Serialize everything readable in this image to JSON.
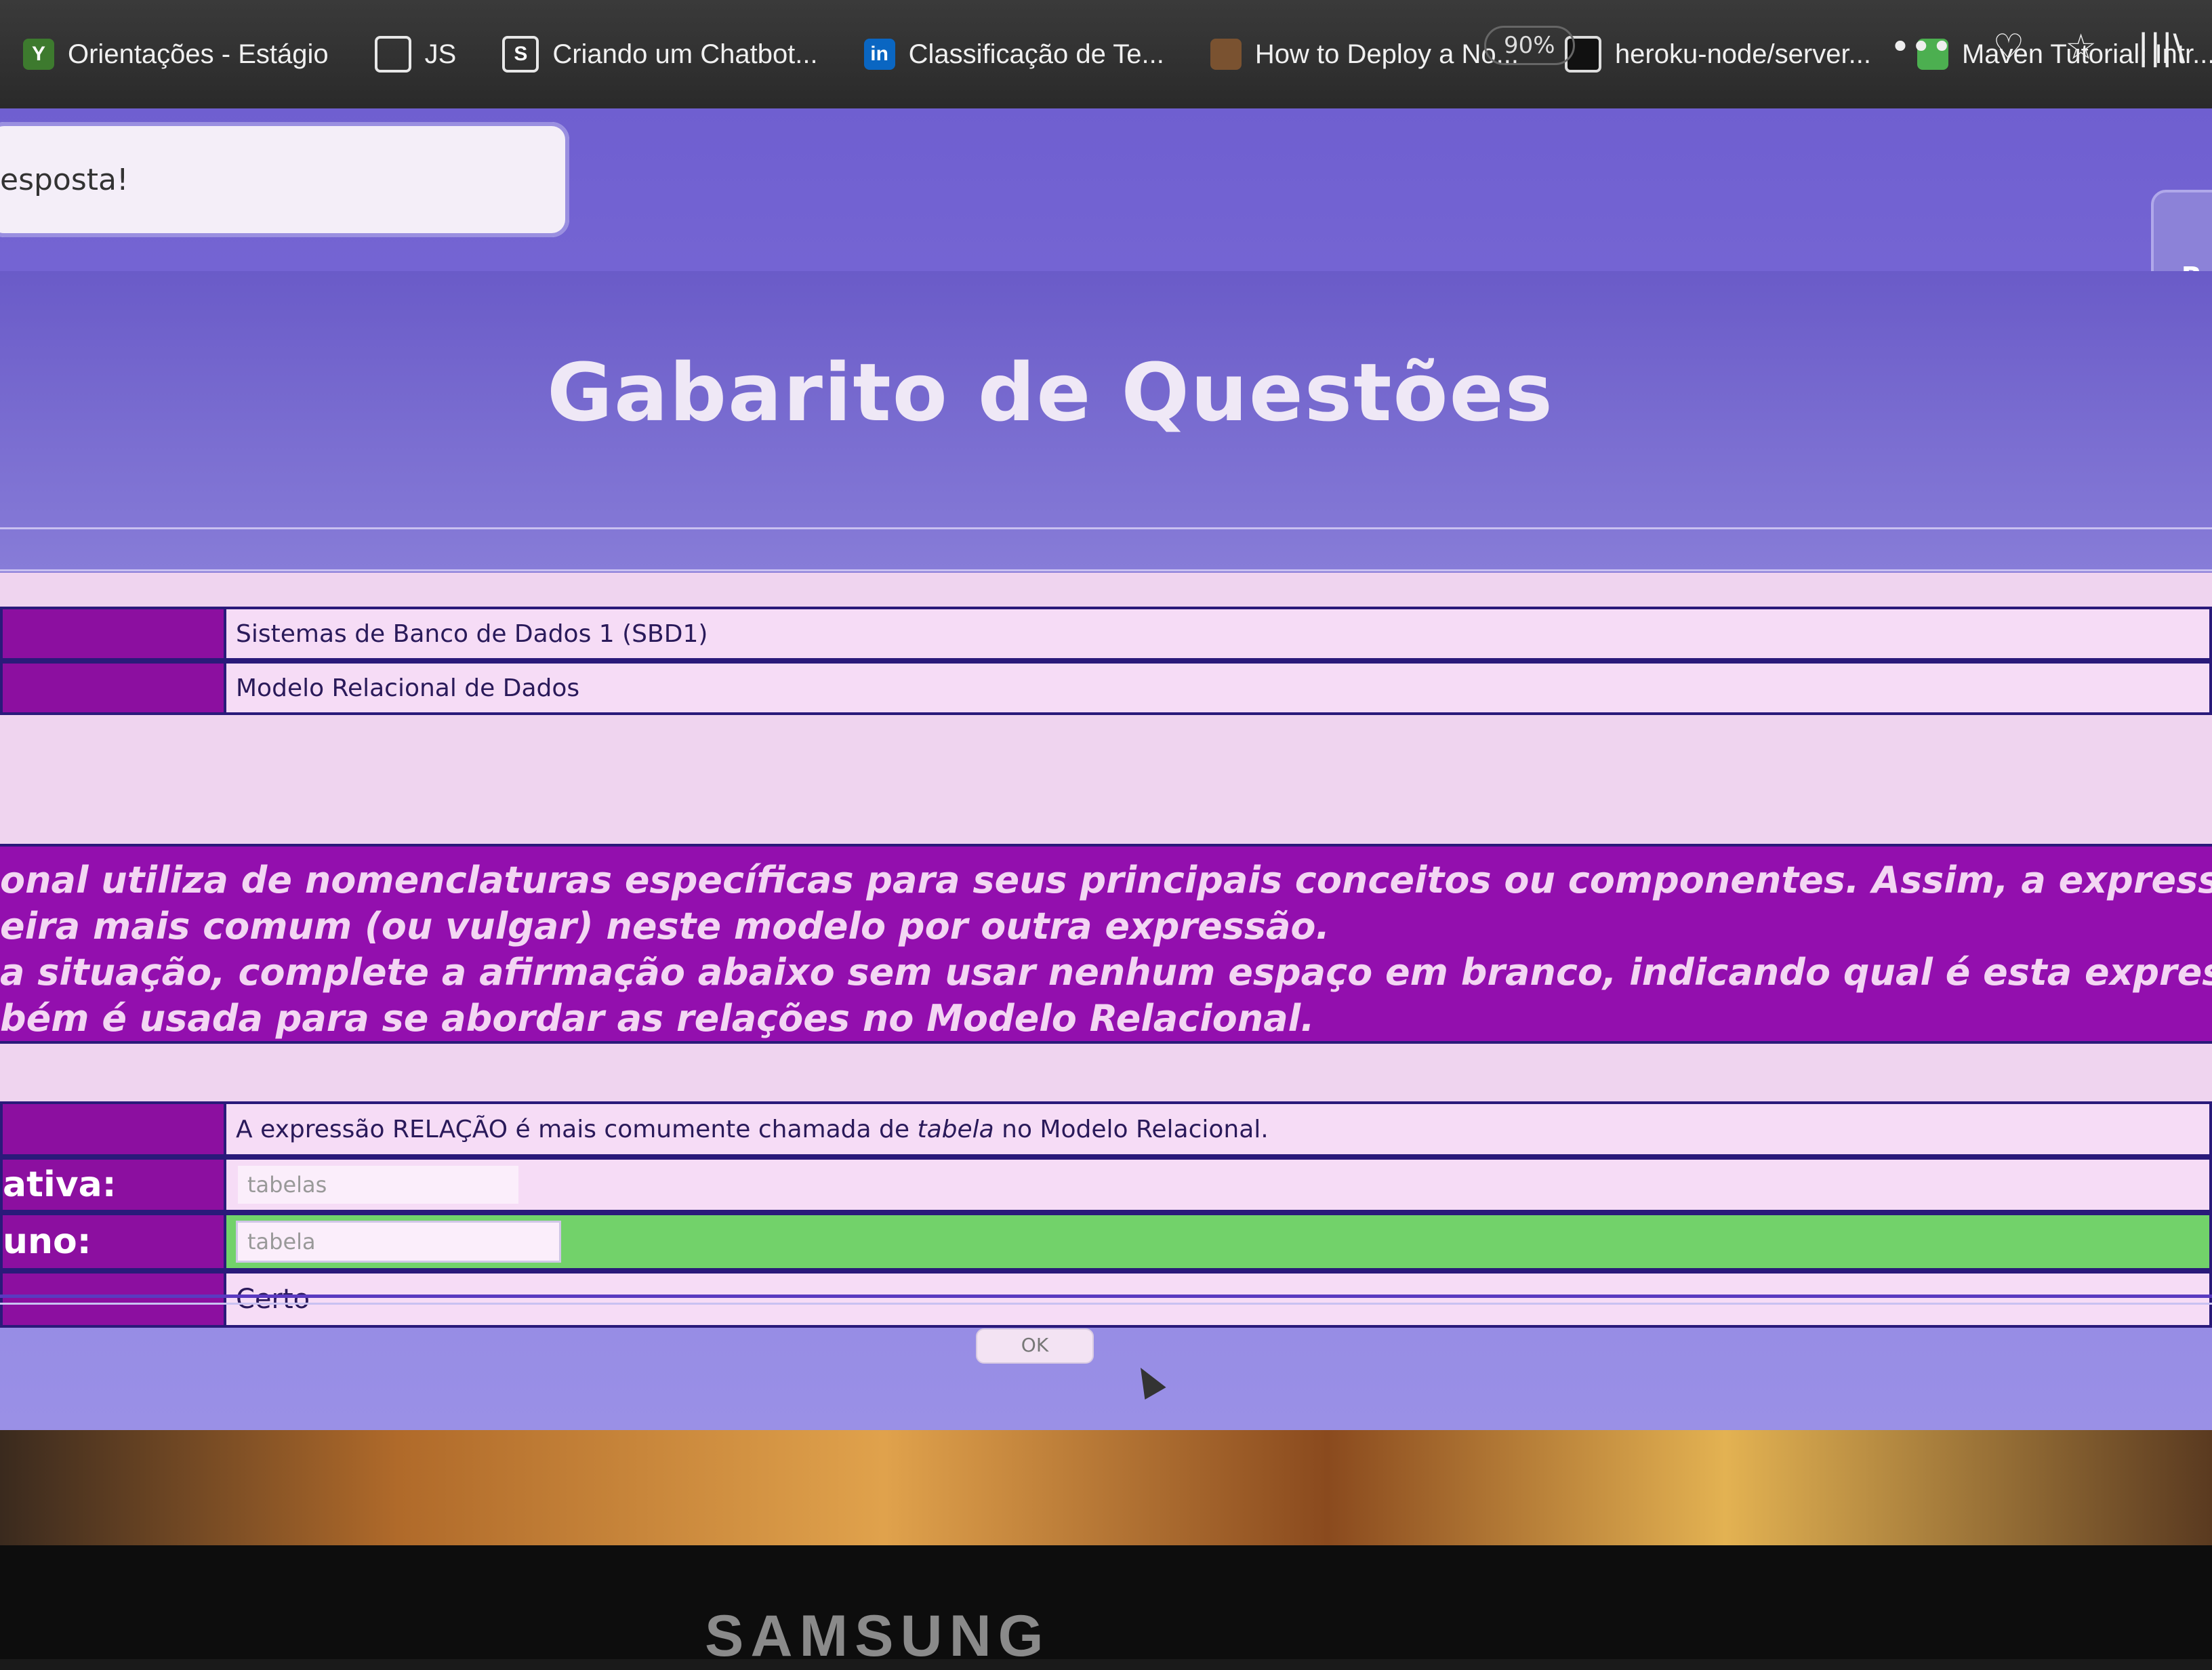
{
  "browser": {
    "bookmarks": [
      {
        "label": "Orientações - Estágio",
        "icon": "yellow-leaf-icon",
        "glyph": "Y"
      },
      {
        "label": "JS",
        "icon": "globe-icon",
        "glyph": ""
      },
      {
        "label": "Criando um Chatbot...",
        "icon": "document-icon",
        "glyph": "S"
      },
      {
        "label": "Classificação de Te...",
        "icon": "linkedin-icon",
        "glyph": "in"
      },
      {
        "label": "How to Deploy a No...",
        "icon": "site-icon",
        "glyph": ""
      },
      {
        "label": "heroku-node/server...",
        "icon": "github-icon",
        "glyph": ""
      },
      {
        "label": "Maven Tutorial: Intr...",
        "icon": "maven-icon",
        "glyph": ""
      }
    ],
    "zoom": "90%",
    "toolbar_icons": {
      "menu": "•••",
      "pocket": "♡",
      "star": "☆",
      "library": "|||\\"
    }
  },
  "page": {
    "message_box": "esposta!",
    "right_button": "R",
    "title": "Gabarito de Questões",
    "info_rows": [
      {
        "value": "Sistemas de Banco de Dados 1 (SBD1)"
      },
      {
        "value": "Modelo Relacional de Dados"
      }
    ],
    "question_lines": [
      "onal utiliza de nomenclaturas específicas para seus principais conceitos ou componentes.  Assim, a expressão RELAÇ",
      "eira mais comum (ou vulgar) neste modelo por outra expressão.",
      "a situação, complete a afirmação abaixo sem usar nenhum espaço em branco, indicando qual é esta expressão mais",
      "bém é usada para se abordar as relações no Modelo Relacional."
    ],
    "answer_rows": {
      "statement": {
        "label": "",
        "text_before": "A expressão RELAÇÃO é mais comumente chamada de ",
        "text_italic": "tabela",
        "text_after": " no Modelo Relacional."
      },
      "alternative": {
        "label": "ativa:",
        "value": "tabelas"
      },
      "student": {
        "label": "uno:",
        "value": "tabela"
      },
      "result": {
        "label": "",
        "value": "Certo"
      }
    },
    "ok_button": "OK"
  },
  "monitor": {
    "brand": "SAMSUNG"
  }
}
